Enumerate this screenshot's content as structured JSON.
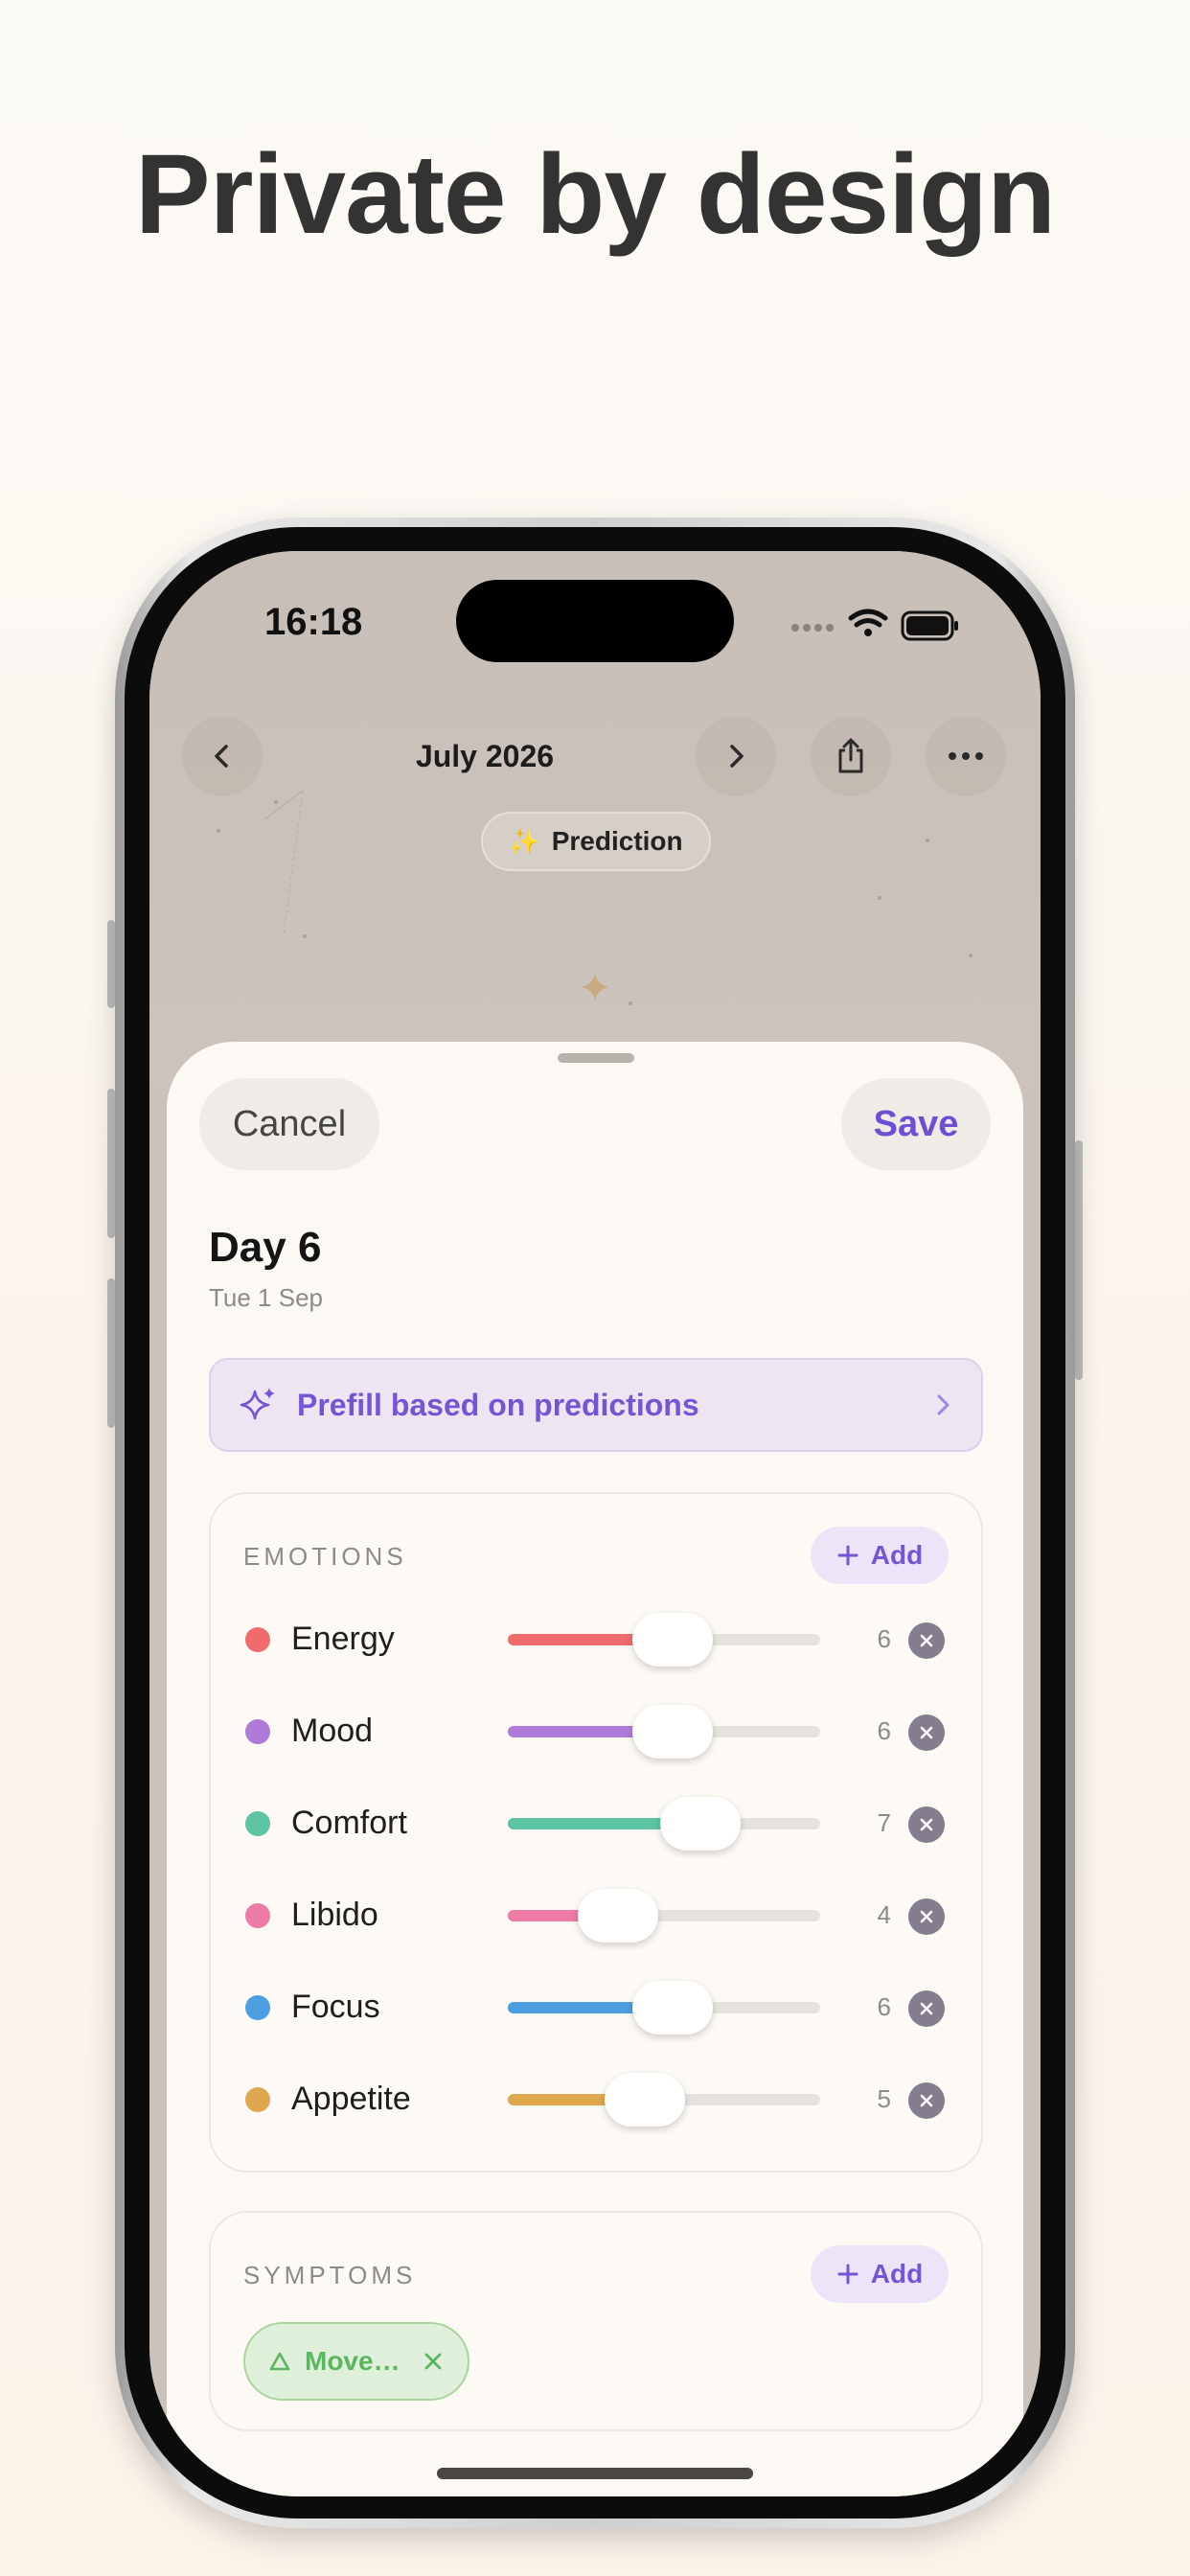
{
  "headline": "Private by design",
  "status_bar": {
    "time": "16:18"
  },
  "nav": {
    "month_title": "July 2026",
    "prediction_chip": {
      "icon": "sparkles-emoji",
      "emoji": "✨",
      "label": "Prediction"
    }
  },
  "sheet": {
    "cancel_label": "Cancel",
    "save_label": "Save",
    "day_title": "Day 6",
    "day_subtitle": "Tue 1 Sep",
    "prefill_label": "Prefill based on predictions",
    "emotions": {
      "section_label": "EMOTIONS",
      "add_label": "Add",
      "items": [
        {
          "label": "Energy",
          "value": "6",
          "color": "#f06b6b",
          "level": 0.6
        },
        {
          "label": "Mood",
          "value": "6",
          "color": "#b07bd8",
          "level": 0.6
        },
        {
          "label": "Comfort",
          "value": "7",
          "color": "#5cc3a3",
          "level": 0.7
        },
        {
          "label": "Libido",
          "value": "4",
          "color": "#ee7aa6",
          "level": 0.4
        },
        {
          "label": "Focus",
          "value": "6",
          "color": "#4d9ee0",
          "level": 0.6
        },
        {
          "label": "Appetite",
          "value": "5",
          "color": "#e0a84e",
          "level": 0.5
        }
      ]
    },
    "symptoms": {
      "section_label": "SYMPTOMS",
      "add_label": "Add",
      "chips": [
        {
          "label": "Move…",
          "color": "#5cb560"
        }
      ]
    }
  },
  "colors": {
    "accent": "#7554d6",
    "background": "#fcfaf6"
  }
}
